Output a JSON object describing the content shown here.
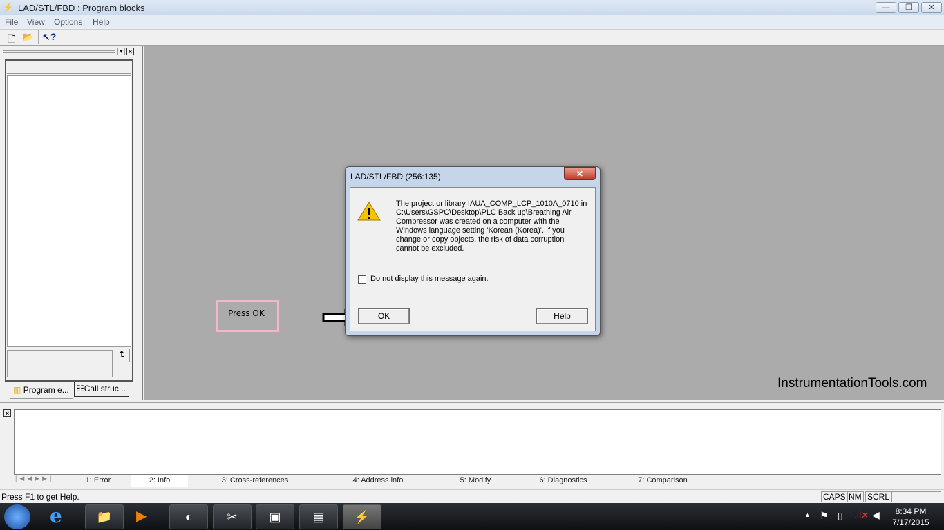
{
  "window": {
    "title": "LAD/STL/FBD : Program blocks",
    "minimize": "—",
    "restore": "❐",
    "close": "✕"
  },
  "menu": [
    "File",
    "View",
    "Options",
    "Help"
  ],
  "toolbar": {
    "icons": [
      "new-document-icon",
      "open-folder-icon",
      "context-help-icon"
    ]
  },
  "left_panel": {
    "tabs": [
      "Program e...",
      "Call struc..."
    ]
  },
  "output_tabs": [
    "1: Error",
    "2: Info",
    "3: Cross-references",
    "4: Address info.",
    "5: Modify",
    "6: Diagnostics",
    "7: Comparison"
  ],
  "status": {
    "help": "Press F1 to get Help.",
    "caps": "CAPS",
    "nm": "NM",
    "scrl": "SCRL"
  },
  "dialog": {
    "title": "LAD/STL/FBD  (256:135)",
    "close": "✕",
    "message_lines": [
      "The project or library IAUA_COMP_LCP_1010A_0710 in",
      "C:\\Users\\GSPC\\Desktop\\PLC Back up\\Breathing Air",
      "Compressor was created on a computer with the",
      "Windows language setting 'Korean (Korea)'. If you",
      "change or copy objects, the risk of data corruption",
      "cannot be excluded."
    ],
    "checkbox_label": "Do not display this message again.",
    "checkbox_checked": false,
    "ok": "OK",
    "help": "Help"
  },
  "annotation": {
    "text": "Press OK",
    "color": "#f4b6c8"
  },
  "watermark": "InstrumentationTools.com",
  "taskbar": {
    "time": "8:34 PM",
    "date": "7/17/2015"
  }
}
